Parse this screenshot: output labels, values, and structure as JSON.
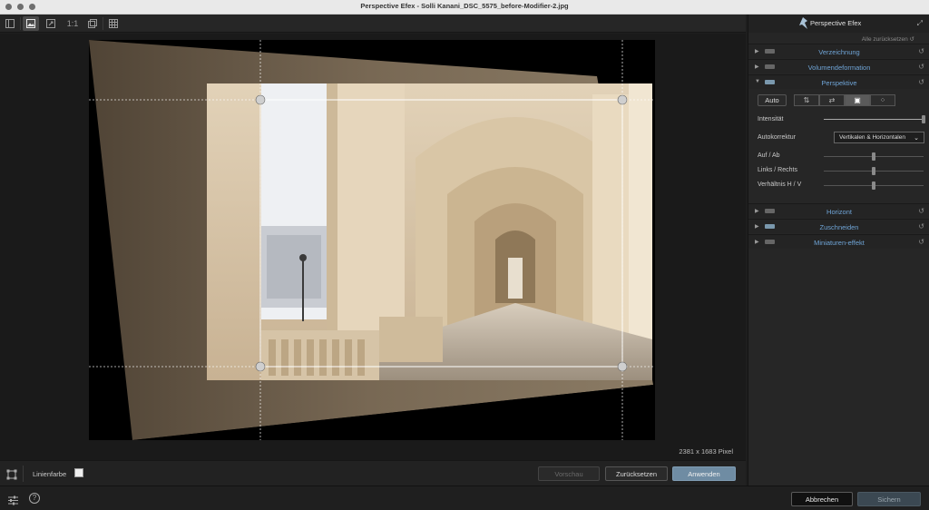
{
  "window": {
    "title": "Perspective Efex - Solli Kanani_DSC_5575_before-Modifier-2.jpg"
  },
  "toolbar": {
    "zoom_label": "1:1"
  },
  "canvas": {
    "image_size": "2381 x 1683 Pixel"
  },
  "bottom": {
    "line_color_label": "Linienfarbe",
    "preview_label": "Vorschau",
    "reset_label": "Zurücksetzen",
    "apply_label": "Anwenden"
  },
  "status": {
    "cancel_label": "Abbrechen",
    "save_label": "Sichern"
  },
  "panel": {
    "app_name": "Perspective Efex",
    "reset_all": "Alle zurücksetzen",
    "sections": [
      {
        "label": "Verzeichnung"
      },
      {
        "label": "Volumendeformation"
      },
      {
        "label": "Perspektive"
      },
      {
        "label": "Horizont"
      },
      {
        "label": "Zuschneiden"
      },
      {
        "label": "Miniaturen-effekt"
      }
    ],
    "perspective": {
      "auto_label": "Auto",
      "intensity_label": "Intensität",
      "intensity_value": 1.0,
      "autocorrect_label": "Autokorrektur",
      "autocorrect_value": "Vertikalen & Horizontalen",
      "updown_label": "Auf / Ab",
      "updown_value": 0.5,
      "leftright_label": "Links / Rechts",
      "leftright_value": 0.5,
      "ratio_label": "Verhältnis H / V",
      "ratio_value": 0.5
    }
  },
  "colors": {
    "accent": "#6fa4d6",
    "primary_button": "#6f8ca3"
  }
}
